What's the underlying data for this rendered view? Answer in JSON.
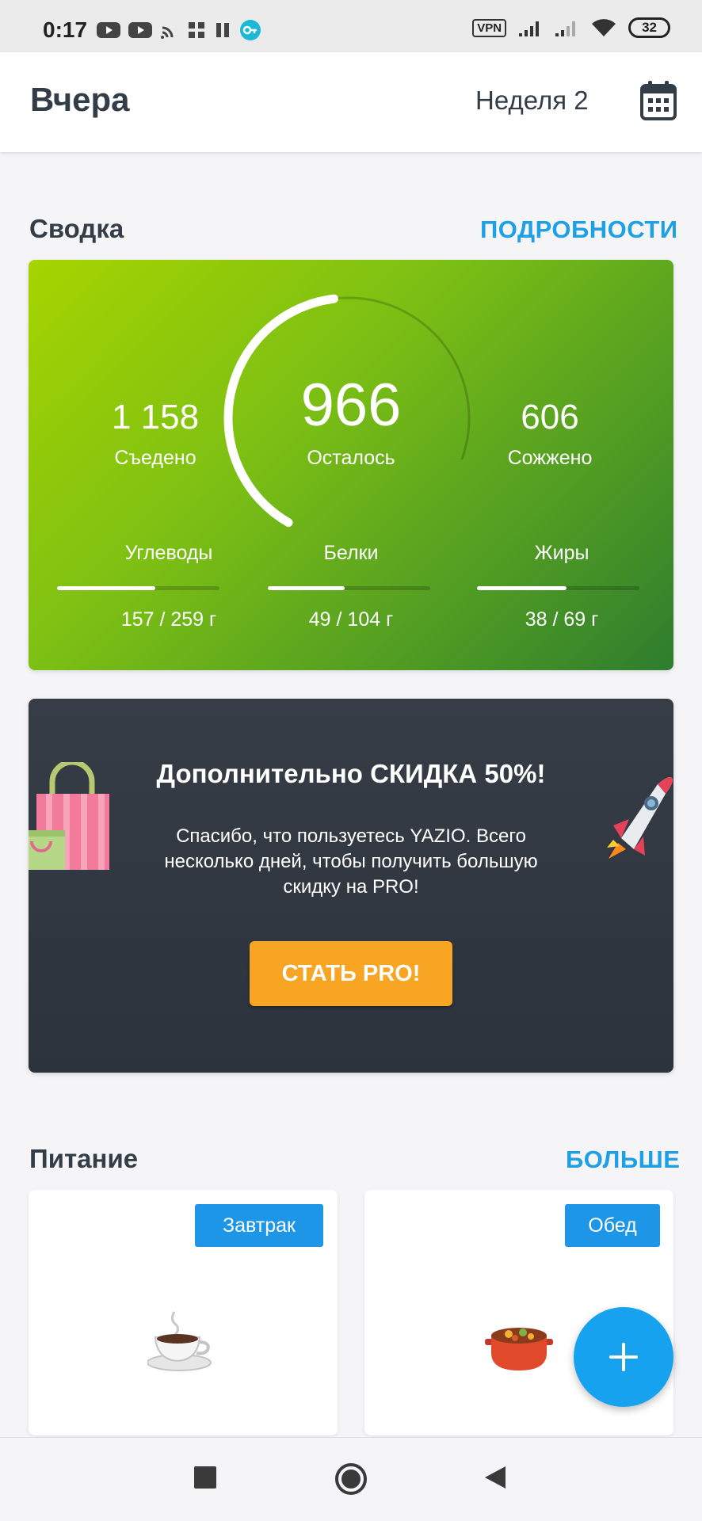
{
  "status_bar": {
    "time": "0:17",
    "vpn": "VPN",
    "battery": "32"
  },
  "header": {
    "title": "Вчера",
    "week": "Неделя 2",
    "calendar_icon": "calendar-icon"
  },
  "summary_section": {
    "title": "Сводка",
    "link": "ПОДРОБНОСТИ",
    "eaten": {
      "value": "1 158",
      "label": "Съедено"
    },
    "remaining": {
      "value": "966",
      "label": "Осталось"
    },
    "burned": {
      "value": "606",
      "label": "Сожжено"
    },
    "gauge_progress": 0.55,
    "macros": [
      {
        "name": "Углеводы",
        "value": "157 / 259 г",
        "progress": 0.606
      },
      {
        "name": "Белки",
        "value": "49 / 104 г",
        "progress": 0.471
      },
      {
        "name": "Жиры",
        "value": "38 / 69 г",
        "progress": 0.551
      }
    ],
    "colors": {
      "gradient_start": "#a6d400",
      "gradient_end": "#2e7d2e"
    }
  },
  "promo": {
    "title": "Дополнительно СКИДКА 50%!",
    "text": "Спасибо, что пользуетесь YAZIO. Всего несколько дней, чтобы получить большую скидку на PRO!",
    "button": "СТАТЬ PRO!",
    "colors": {
      "button": "#f8a523",
      "background": "#2f3640"
    }
  },
  "nutrition_section": {
    "title": "Питание",
    "link": "БОЛЬШЕ",
    "meals": [
      {
        "badge": "Завтрак",
        "icon": "coffee-cup-icon"
      },
      {
        "badge": "Обед",
        "icon": "stew-pot-icon"
      }
    ]
  },
  "fab": {
    "icon": "plus-icon",
    "color": "#17a2f0"
  },
  "nav": {
    "icons": [
      "recents-square-icon",
      "home-circle-icon",
      "back-triangle-icon"
    ]
  }
}
